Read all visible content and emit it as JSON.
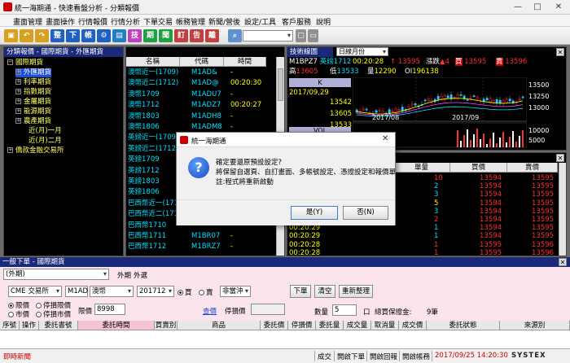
{
  "window": {
    "title": "統一海期通 - 快速看盤分析 - 分類報價",
    "min": "—",
    "max": "□",
    "close": "✕"
  },
  "menu": [
    "畫面管理",
    "畫面操作",
    "行情報價",
    "行情分析",
    "下單交易",
    "帳務管理",
    "新聞/營後",
    "設定/工具",
    "客戶服務",
    "說明"
  ],
  "toolbar": {
    "buttons": [
      {
        "label": "",
        "color": "#d8a020"
      },
      {
        "label": "",
        "color": "#d8a020"
      },
      {
        "label": "",
        "color": "#d8a020"
      },
      {
        "label": "整",
        "color": "#2060c0"
      },
      {
        "label": "下",
        "color": "#2060c0"
      },
      {
        "label": "帳",
        "color": "#2060c0"
      },
      {
        "label": "",
        "color": "#2060c0"
      },
      {
        "label": "",
        "color": "#2060c0"
      },
      {
        "label": "技",
        "color": "#c040c0"
      },
      {
        "label": "期",
        "color": "#20a040"
      },
      {
        "label": "聞",
        "color": "#20a040"
      },
      {
        "label": "訂",
        "color": "#c04040"
      },
      {
        "label": "告",
        "color": "#c04040"
      },
      {
        "label": "離",
        "color": "#c04040"
      }
    ]
  },
  "tree": {
    "header": "分類報價 - 國際期貨 - 外匯期貨",
    "items": [
      {
        "label": "國際期貨",
        "indent": 0,
        "box": "−",
        "selected": false
      },
      {
        "label": "外匯期貨",
        "indent": 1,
        "box": "+",
        "selected": true
      },
      {
        "label": "利率期貨",
        "indent": 1,
        "box": "+",
        "selected": false
      },
      {
        "label": "指數期貨",
        "indent": 1,
        "box": "+",
        "selected": false
      },
      {
        "label": "金屬期貨",
        "indent": 1,
        "box": "+",
        "selected": false
      },
      {
        "label": "能源期貨",
        "indent": 1,
        "box": "+",
        "selected": false
      },
      {
        "label": "農產期貨",
        "indent": 1,
        "box": "+",
        "selected": false
      },
      {
        "label": "近(月)一月",
        "indent": 2,
        "box": "",
        "selected": false
      },
      {
        "label": "近(月)二月",
        "indent": 2,
        "box": "",
        "selected": false
      },
      {
        "label": "僑款金融交易所",
        "indent": 0,
        "box": "+",
        "selected": false
      }
    ]
  },
  "quotes": {
    "columns": [
      "名稱",
      "代碼",
      "時間"
    ],
    "rows": [
      {
        "name": "澳幣近一(1709)",
        "code": "M1AD&",
        "time": "-"
      },
      {
        "name": "澳幣近二(1712)",
        "code": "M1AD@",
        "time": "00:20:30"
      },
      {
        "name": "澳幣1709",
        "code": "M1ADU7",
        "time": "-"
      },
      {
        "name": "澳幣1712",
        "code": "M1ADZ7",
        "time": "00:20:27"
      },
      {
        "name": "澳幣1803",
        "code": "M1ADH8",
        "time": "-"
      },
      {
        "name": "澳幣1806",
        "code": "M1ADM8",
        "time": "-"
      },
      {
        "name": "英鎊近一(1709)",
        "code": "",
        "time": ""
      },
      {
        "name": "英鎊近二(1712)",
        "code": "",
        "time": ""
      },
      {
        "name": "英鎊1709",
        "code": "",
        "time": ""
      },
      {
        "name": "英鎊1712",
        "code": "",
        "time": ""
      },
      {
        "name": "英鎊1803",
        "code": "",
        "time": ""
      },
      {
        "name": "英鎊1806",
        "code": "",
        "time": ""
      },
      {
        "name": "巴西幣近一(1711)",
        "code": "",
        "time": ""
      },
      {
        "name": "巴西幣近二(1712)",
        "code": "",
        "time": ""
      },
      {
        "name": "巴西幣1710",
        "code": "",
        "time": ""
      },
      {
        "name": "巴西幣1711",
        "code": "M1BR07",
        "time": "-"
      },
      {
        "name": "巴西幣1712",
        "code": "M1BRZ7",
        "time": "-"
      }
    ]
  },
  "tech": {
    "header": "技術線圖",
    "period": "日線月份",
    "code": "M1BPZ7",
    "name": "英鎊1712",
    "time": "00:20:28",
    "price": "13595",
    "change_label": "漲跌",
    "change": "4",
    "buy_label": "買",
    "buy": "13595",
    "sell_label": "賣",
    "sell": "13596",
    "high_label": "高",
    "high": "13605",
    "low_label": "低",
    "low": "13533",
    "vol_label": "量",
    "vol": "12290",
    "oi_label": "OI",
    "oi": "196138",
    "k_tab": "K",
    "vol_tab": "VOL",
    "info_date": "2017/09,29",
    "info_values": [
      "13542",
      "13605",
      "13533"
    ],
    "y_ticks": [
      "13500",
      "13250",
      "13000"
    ],
    "x_ticks": [
      "2017/08",
      "2017/09"
    ],
    "vol_ticks": [
      "10000",
      "5000"
    ]
  },
  "ticks": {
    "columns": [
      "時間",
      "單量",
      "買價",
      "賣價"
    ],
    "rows": [
      {
        "time": "00:20:30",
        "vol": "10",
        "bid": "13594",
        "ask": "13595",
        "color": "red"
      },
      {
        "time": "00:20:30",
        "vol": "2",
        "bid": "13594",
        "ask": "13595",
        "color": "cyan"
      },
      {
        "time": "00:20:30",
        "vol": "3",
        "bid": "13594",
        "ask": "13595",
        "color": "cyan"
      },
      {
        "time": "00:20:30",
        "vol": "5",
        "bid": "13594",
        "ask": "13595",
        "color": "yel"
      },
      {
        "time": "00:20:30",
        "vol": "3",
        "bid": "13594",
        "ask": "13595",
        "color": "cyan"
      },
      {
        "time": "00:20:30",
        "vol": "2",
        "bid": "13594",
        "ask": "13595",
        "color": "red"
      },
      {
        "time": "00:20:29",
        "vol": "1",
        "bid": "13594",
        "ask": "13595",
        "color": "cyan"
      },
      {
        "time": "00:20:29",
        "vol": "1",
        "bid": "13594",
        "ask": "13595",
        "color": "cyan"
      },
      {
        "time": "00:20:28",
        "vol": "1",
        "bid": "13595",
        "ask": "13596",
        "color": "red"
      },
      {
        "time": "00:20:28",
        "vol": "1",
        "bid": "13595",
        "ask": "13596",
        "color": "red"
      }
    ]
  },
  "dialog": {
    "title": "統一海期通",
    "line1": "確定要還原預設設定?",
    "line2": "將保留自選頁、自訂畫面、多帳號設定、憑證設定和報價單",
    "line3": "註:程式將重新啟動",
    "yes": "是(Y)",
    "no": "否(N)"
  },
  "order": {
    "header": "一般下單 - 國際期貨",
    "account": "(外期)",
    "tab1": "外期",
    "tab2": "外選",
    "exchange": "CME 交易所",
    "symbol": "M1AD",
    "symbol_name": "澳幣",
    "month": "201712",
    "buy": "買",
    "sell": "賣",
    "type": "非當沖",
    "submit": "下單",
    "clear": "清空",
    "reset": "重新整理",
    "limit": "限價",
    "stop_limit": "停損限價",
    "market": "市價",
    "stop_market": "停損市價",
    "price_label": "限價",
    "price": "8998",
    "query": "查價",
    "stop_label": "停損價",
    "qty_label": "數量",
    "qty": "5",
    "qty_unit": "口",
    "total_label": "總買保證金:",
    "total": "9筆",
    "columns": [
      "序號",
      "操作",
      "委託書號",
      "委託時間",
      "買賣別",
      "商品",
      "委託價",
      "停損價",
      "委託量",
      "成交量",
      "取消量",
      "成交價",
      "委託狀態",
      "來源別"
    ]
  },
  "status": {
    "left": "即時新聞",
    "items": [
      "成交",
      "開啟下單",
      "開啟回報",
      "開啟帳務"
    ],
    "datetime": "2017/09/25 14:20:30",
    "brand": "SYSTEX"
  }
}
